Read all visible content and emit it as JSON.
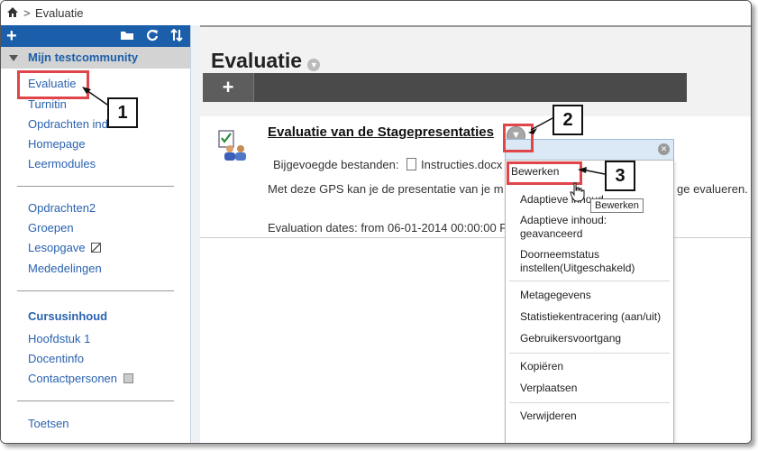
{
  "breadcrumb": {
    "separator": ">",
    "current": "Evaluatie"
  },
  "sidebar": {
    "community": "Mijn testcommunity",
    "items1": [
      "Evaluatie",
      "Turnitin",
      "Opdrachten indienen",
      "Homepage",
      "Leermodules"
    ],
    "items2": [
      "Opdrachten2",
      "Groepen",
      "Lesopgave",
      "Mededelingen"
    ],
    "section_title": "Cursusinhoud",
    "items3": [
      "Hoofdstuk 1",
      "Docentinfo",
      "Contactpersonen"
    ],
    "items4": [
      "Toetsen"
    ]
  },
  "main": {
    "title": "Evaluatie",
    "item_title": "Evaluatie van de Stagepresentaties",
    "attachments_label": "Bijgevoegde bestanden:",
    "attachment_name": "Instructies.docx",
    "description": "Met deze GPS kan je de presentatie van je m",
    "description_tail": "ge evalueren.",
    "dates": "Evaluation dates: from 06-01-2014 00:00:00 F"
  },
  "menu": {
    "items": [
      "Bewerken",
      "Adaptieve inhoud",
      "Adaptieve inhoud: geavanceerd",
      "Doorneemstatus instellen(Uitgeschakeld)",
      "Metagegevens",
      "Statistiekentracering (aan/uit)",
      "Gebruikersvoortgang",
      "Kopiëren",
      "Verplaatsen",
      "Verwijderen"
    ],
    "tooltip": "Bewerken"
  },
  "callouts": [
    "1",
    "2",
    "3"
  ],
  "colors": {
    "link": "#2a62b0",
    "sidebar_bar": "#1b5ea9",
    "highlight": "#e0454a"
  }
}
